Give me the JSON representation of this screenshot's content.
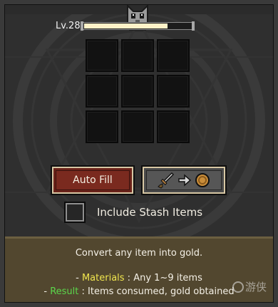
{
  "header": {
    "level_text": "Lv.28",
    "xp_progress": 0.78
  },
  "grid": {
    "slots": 9
  },
  "buttons": {
    "auto_fill_label": "Auto Fill",
    "convert_icons": [
      "sword-icon",
      "arrow-right-icon",
      "gold-coin-icon"
    ]
  },
  "stash": {
    "label": "Include Stash Items",
    "checked": false
  },
  "info": {
    "line1": "Convert any item into gold.",
    "materials_prefix": "- ",
    "materials_key": "Materials",
    "materials_value": " : Any 1~9 items",
    "result_prefix": "- ",
    "result_key": "Result",
    "result_value": " : Items consumed, gold obtained"
  },
  "watermark": {
    "text": "游侠"
  },
  "colors": {
    "materials": "#f1e64e",
    "result": "#5bd64b",
    "auto_fill_bg": "#6b231a",
    "panel_bg": "#52472f"
  }
}
